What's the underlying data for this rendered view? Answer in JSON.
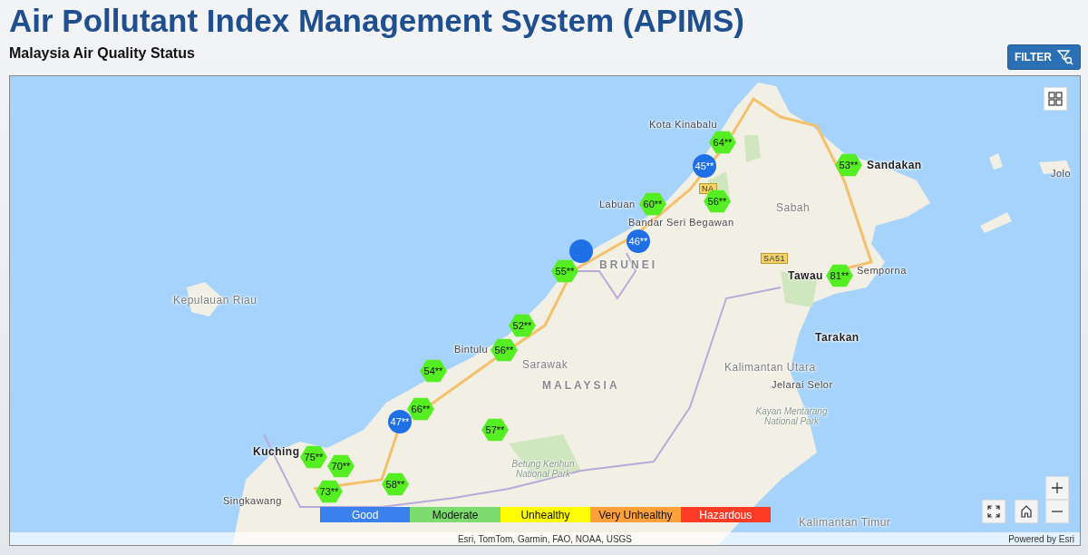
{
  "header": {
    "title": "Air Pollutant Index Management System (APIMS)",
    "subtitle": "Malaysia Air Quality Status",
    "filter_button": "FILTER"
  },
  "map": {
    "labels": [
      {
        "kind": "minor",
        "text": "Jolo"
      },
      {
        "kind": "minor",
        "text": "Kota Kinabalu"
      },
      {
        "kind": "city",
        "text": "Sandakan"
      },
      {
        "kind": "minor",
        "text": "Labuan"
      },
      {
        "kind": "minor",
        "text": "Bandar Seri Begawan"
      },
      {
        "kind": "region",
        "text": "Sabah"
      },
      {
        "kind": "country",
        "text": "BRUNEI"
      },
      {
        "kind": "minor",
        "text": "Semporna"
      },
      {
        "kind": "city",
        "text": "Tawau"
      },
      {
        "kind": "region",
        "text": "Kepulauan Riau"
      },
      {
        "kind": "city",
        "text": "Tarakan"
      },
      {
        "kind": "minor",
        "text": "Bintulu"
      },
      {
        "kind": "region",
        "text": "Sarawak"
      },
      {
        "kind": "country",
        "text": "MALAYSIA"
      },
      {
        "kind": "region",
        "text": "Kalimantan Utara"
      },
      {
        "kind": "minor",
        "text": "Jelarai Selor"
      },
      {
        "kind": "park",
        "text": "Kayan Mentarang National Park"
      },
      {
        "kind": "city",
        "text": "Kuching"
      },
      {
        "kind": "minor",
        "text": "Singkawang"
      },
      {
        "kind": "park",
        "text": "Betung Kerihun National Park"
      },
      {
        "kind": "region",
        "text": "Kalimantan Timur"
      },
      {
        "kind": "shield",
        "text": "NA"
      },
      {
        "kind": "shield",
        "text": "SA51"
      }
    ],
    "markers": [
      {
        "kind": "circle",
        "color": "#1f6fe6"
      },
      {
        "kind": "hexagon",
        "color": "#55ee22",
        "value": "64**"
      },
      {
        "kind": "circle",
        "color": "#1f6fe6",
        "value": "45**"
      },
      {
        "kind": "hexagon",
        "color": "#55ee22",
        "value": "53**"
      },
      {
        "kind": "hexagon",
        "color": "#55ee22",
        "value": "60**"
      },
      {
        "kind": "hexagon",
        "color": "#55ee22",
        "value": "56**"
      },
      {
        "kind": "circle",
        "color": "#1f6fe6",
        "value": "46**"
      },
      {
        "kind": "hexagon",
        "color": "#55ee22",
        "value": "55**"
      },
      {
        "kind": "hexagon",
        "color": "#55ee22",
        "value": "81**"
      },
      {
        "kind": "hexagon",
        "color": "#55ee22",
        "value": "52**"
      },
      {
        "kind": "hexagon",
        "color": "#55ee22",
        "value": "56**"
      },
      {
        "kind": "hexagon",
        "color": "#55ee22",
        "value": "54**"
      },
      {
        "kind": "hexagon",
        "color": "#55ee22",
        "value": "66**"
      },
      {
        "kind": "circle",
        "color": "#1f6fe6",
        "value": "47**"
      },
      {
        "kind": "hexagon",
        "color": "#55ee22",
        "value": "57**"
      },
      {
        "kind": "hexagon",
        "color": "#55ee22",
        "value": "75**"
      },
      {
        "kind": "hexagon",
        "color": "#55ee22",
        "value": "70**"
      },
      {
        "kind": "hexagon",
        "color": "#55ee22",
        "value": "73**"
      },
      {
        "kind": "hexagon",
        "color": "#55ee22",
        "value": "58**"
      }
    ],
    "legend": [
      {
        "label": "Good",
        "color": "#3a80ee"
      },
      {
        "label": "Moderate",
        "color": "#7ddc6e"
      },
      {
        "label": "Unhealthy",
        "color": "#ffff00"
      },
      {
        "label": "Very Unhealthy",
        "color": "#ffa13a"
      },
      {
        "label": "Hazardous",
        "color": "#ff3b25"
      }
    ],
    "attribution": "Esri, TomTom, Garmin, FAO, NOAA, USGS",
    "powered_by": "Powered by Esri"
  }
}
